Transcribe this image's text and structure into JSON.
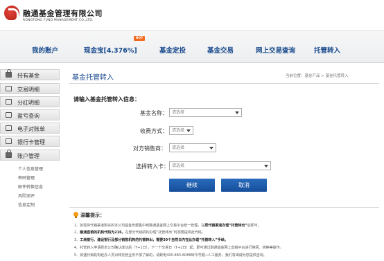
{
  "header": {
    "logo_cn": "融通基金管理有限公司",
    "logo_en": "RONGTONG FUND MANAGEMENT CO.,LTD."
  },
  "nav": {
    "items": [
      "我的账户",
      "现金宝[4.376%]",
      "基金定投",
      "基金交易",
      "网上交易查询",
      "托管转入"
    ],
    "hot_badge": "HOT"
  },
  "sidebar": {
    "items": [
      "持有基金",
      "交易明细",
      "分红明细",
      "盈亏查询",
      "电子对账单",
      "银行卡管理",
      "账户管理"
    ],
    "sub_items": [
      "个人信息管理",
      "密码管理",
      "邮件转换信息",
      "风险测评",
      "信息定制"
    ]
  },
  "main": {
    "title": "基金托管转入",
    "breadcrumb": "当前位置：基金产品 > 基金托管转入",
    "form_title": "请输入基金托管转入信息：",
    "fields": [
      {
        "label": "基金名称：",
        "value": "请选择"
      },
      {
        "label": "收费方式：",
        "value": "请选择"
      },
      {
        "label": "对方销售商：",
        "value": "请选择"
      },
      {
        "label": "选择转入卡：",
        "value": "请选择"
      }
    ],
    "buttons": {
      "submit": "继续",
      "cancel": "取消"
    }
  },
  "tips": {
    "title": "温馨提示：",
    "lines": [
      {
        "pre": "1、如需将代销渠道购买的本公司基金份额集中到融通基金网上交易平台统一管理，在",
        "bold": "原代销渠道办理“托管转出”",
        "post": "后即可。"
      },
      {
        "pre": "2、",
        "bold": "融通直销的机构代码为216，",
        "post": "在部分代销机构办理“托管转出”时需要提供此代码。"
      },
      {
        "pre": "3、",
        "bold": "工商银行、建设银行及部分销售机构的托管转出，需要30个自然日内在此办理“托管转入”手续。",
        "post": ""
      },
      {
        "pre": "4、托管转入申请经本公司确认成功后（T+1日），下一个交易日（T+2日）起，即可通过融通基金网上直销平台进行赎回、转换等操作。",
        "bold": "",
        "post": ""
      },
      {
        "pre": "5、如遇代销机构经办人员对转托管业务不够了解的，请致电400-883-8088转今号键→人工服务，我们将竭诚为您提供咨询。",
        "bold": "",
        "post": ""
      }
    ]
  },
  "colors": {
    "brand": "#1a4b8e",
    "accent": "#c0241b",
    "button": "#1f5ca8",
    "hot": "#f26b1d"
  }
}
